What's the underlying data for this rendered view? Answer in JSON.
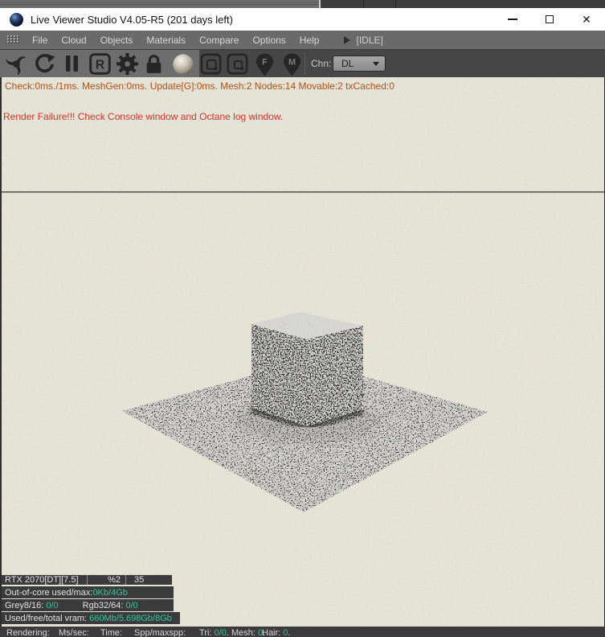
{
  "window": {
    "title": "Live Viewer Studio V4.05-R5 (201 days left)",
    "controls": {
      "minimize": "minimize",
      "maximize": "maximize",
      "close": "✕"
    }
  },
  "menu": {
    "items": [
      "File",
      "Cloud",
      "Objects",
      "Materials",
      "Compare",
      "Options",
      "Help"
    ],
    "status": "[IDLE]"
  },
  "toolbar": {
    "chn_label": "Chn:",
    "channel_value": "DL",
    "r_label": "R",
    "pin_f_label": "F",
    "pin_m_label": "M",
    "icons": [
      "octane-swirl-icon",
      "refresh-icon",
      "pause-icon",
      "restart-r-icon",
      "gear-icon",
      "lock-icon",
      "material-ball-icon",
      "pick-region-icon",
      "pick-region2-icon",
      "pin-f-icon",
      "pin-m-icon"
    ]
  },
  "status_line": {
    "text": "Check:0ms./1ms. MeshGen:0ms. Update[G]:0ms. Mesh:2 Nodes:14 Movable:2 txCached:0"
  },
  "error_line": {
    "text": "Render Failure!!! Check Console window and Octane log window."
  },
  "gpu_panel": {
    "device": "RTX 2070[DT][7.5]",
    "percent": "%2",
    "value": "35",
    "out_of_core_label": "Out-of-core used/max:",
    "out_of_core_value": "0Kb/4Gb",
    "grey_label": "Grey8/16: ",
    "grey_value": "0/0",
    "rgb_label": "Rgb32/64: ",
    "rgb_value": "0/0",
    "vram_label": "Used/free/total vram: ",
    "vram_value": "660Mb/5.698Gb/8Gb"
  },
  "bottom_bar": {
    "rendering_label": "Rendering:",
    "ms_label": "Ms/sec:",
    "time_label": "Time:",
    "spp_label": "Spp/maxspp:",
    "tri_label": "Tri: ",
    "tri_value": "0/0",
    "dot": ".",
    "mesh_label": "Mesh: ",
    "mesh_value": "0",
    "hair_label": "Hair: ",
    "hair_value": "0"
  },
  "colors": {
    "accent_teal": "#35c39e",
    "status_orange": "#b0501a",
    "error_red": "#cf352c",
    "viewport_beige": "#eceadb",
    "dark_bar": "#3b3b3b",
    "toolbar_gray": "#6d6d6d"
  }
}
